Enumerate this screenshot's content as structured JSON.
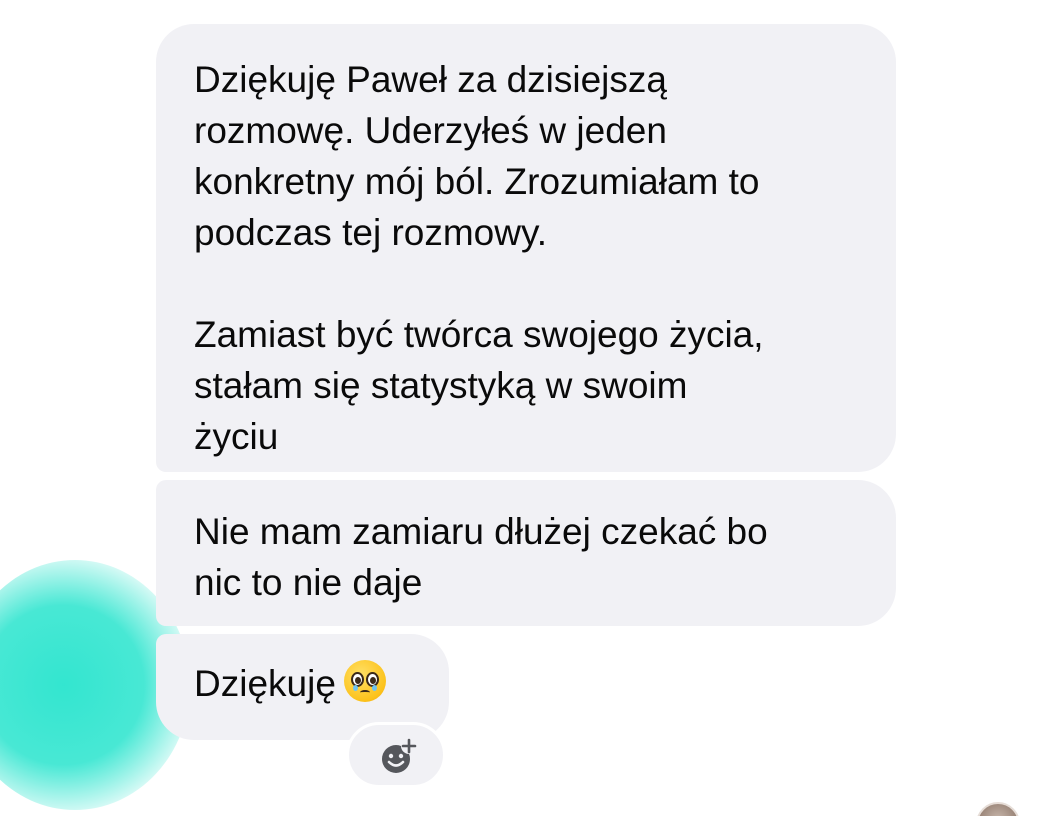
{
  "messages": [
    {
      "lines_p1": [
        "Dziękuję Paweł za dzisiejszą",
        "rozmowę. Uderzyłeś w jeden",
        "konkretny mój ból. Zrozumiałam to",
        "podczas tej rozmowy."
      ],
      "lines_p2": [
        "Zamiast być twórca swojego życia,",
        "stałam się statystyką w swoim",
        "życiu"
      ]
    },
    {
      "lines": [
        "Nie mam zamiaru dłużej czekać bo",
        "nic to nie daje"
      ]
    },
    {
      "text": "Dziękuję",
      "emoji": "pleading-face-icon"
    }
  ],
  "reaction_button": {
    "icon": "add-reaction-icon"
  },
  "colors": {
    "bubble_bg": "#f1f1f5",
    "text": "#0a0a0a",
    "smudge": "#28e4cd"
  }
}
